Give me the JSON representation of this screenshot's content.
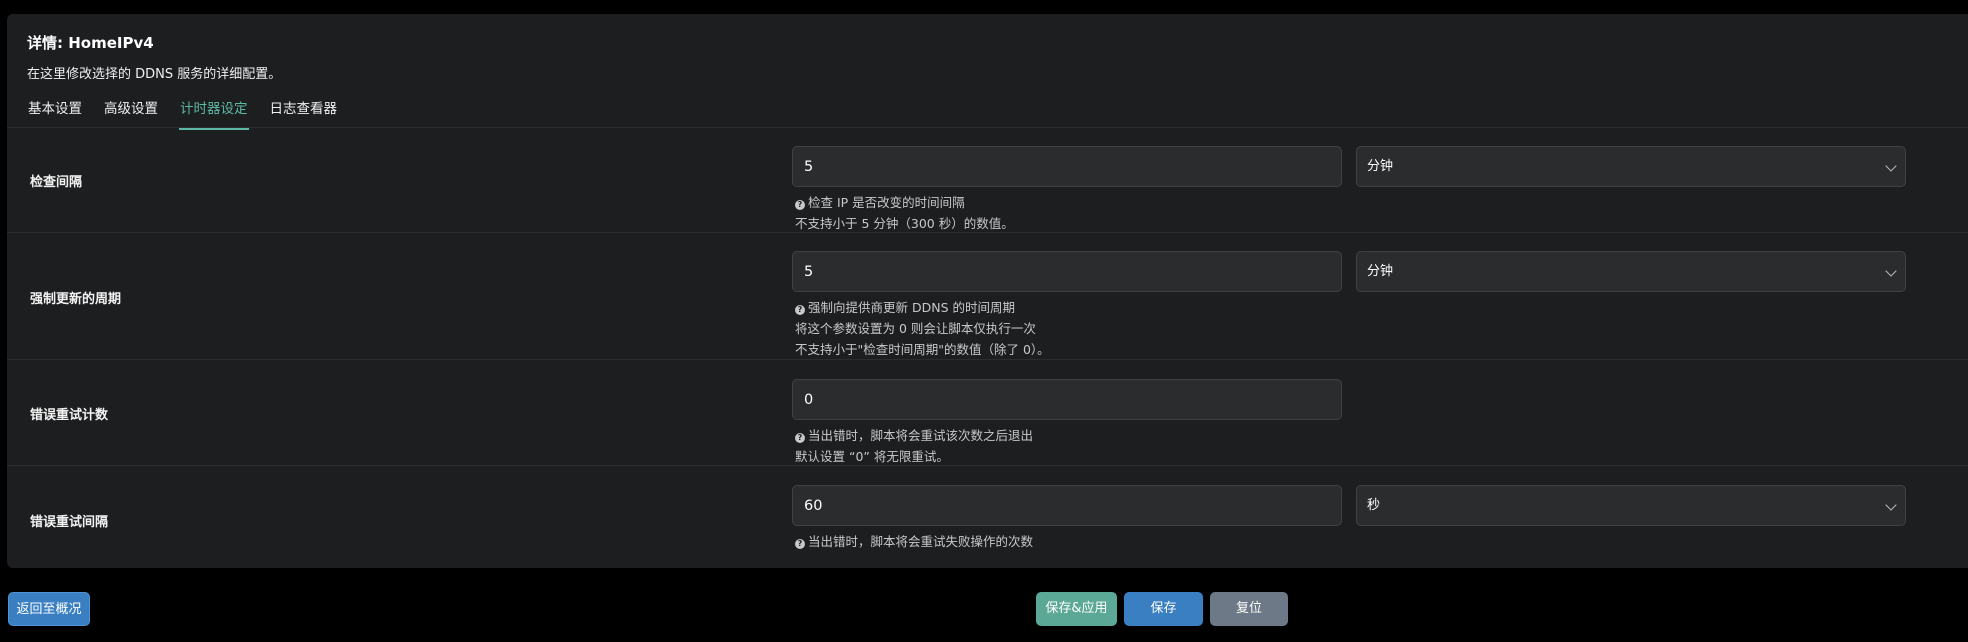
{
  "panel": {
    "title": "详情: HomeIPv4",
    "description": "在这里修改选择的 DDNS 服务的详细配置。"
  },
  "tabs": [
    {
      "label": "基本设置",
      "active": false
    },
    {
      "label": "高级设置",
      "active": false
    },
    {
      "label": "计时器设定",
      "active": true
    },
    {
      "label": "日志查看器",
      "active": false
    }
  ],
  "rows": [
    {
      "label": "检查间隔",
      "value": "5",
      "unit": "分钟",
      "help": [
        "检查 IP 是否改变的时间间隔",
        "不支持小于 5 分钟（300 秒）的数值。"
      ]
    },
    {
      "label": "强制更新的周期",
      "value": "5",
      "unit": "分钟",
      "help": [
        "强制向提供商更新 DDNS 的时间周期",
        "将这个参数设置为 0 则会让脚本仅执行一次",
        "不支持小于\"检查时间周期\"的数值（除了 0）。"
      ]
    },
    {
      "label": "错误重试计数",
      "value": "0",
      "help": [
        "当出错时，脚本将会重试该次数之后退出",
        "默认设置 “0” 将无限重试。"
      ]
    },
    {
      "label": "错误重试间隔",
      "value": "60",
      "unit": "秒",
      "help": [
        "当出错时，脚本将会重试失败操作的次数"
      ]
    }
  ],
  "buttons": {
    "back": "返回至概况",
    "save_apply": "保存&应用",
    "save": "保存",
    "reset": "复位"
  },
  "colors": {
    "accent_tab": "#5fb8a4",
    "primary": "#3a7fc1",
    "apply": "#5ca897",
    "reset": "#6d7986"
  }
}
